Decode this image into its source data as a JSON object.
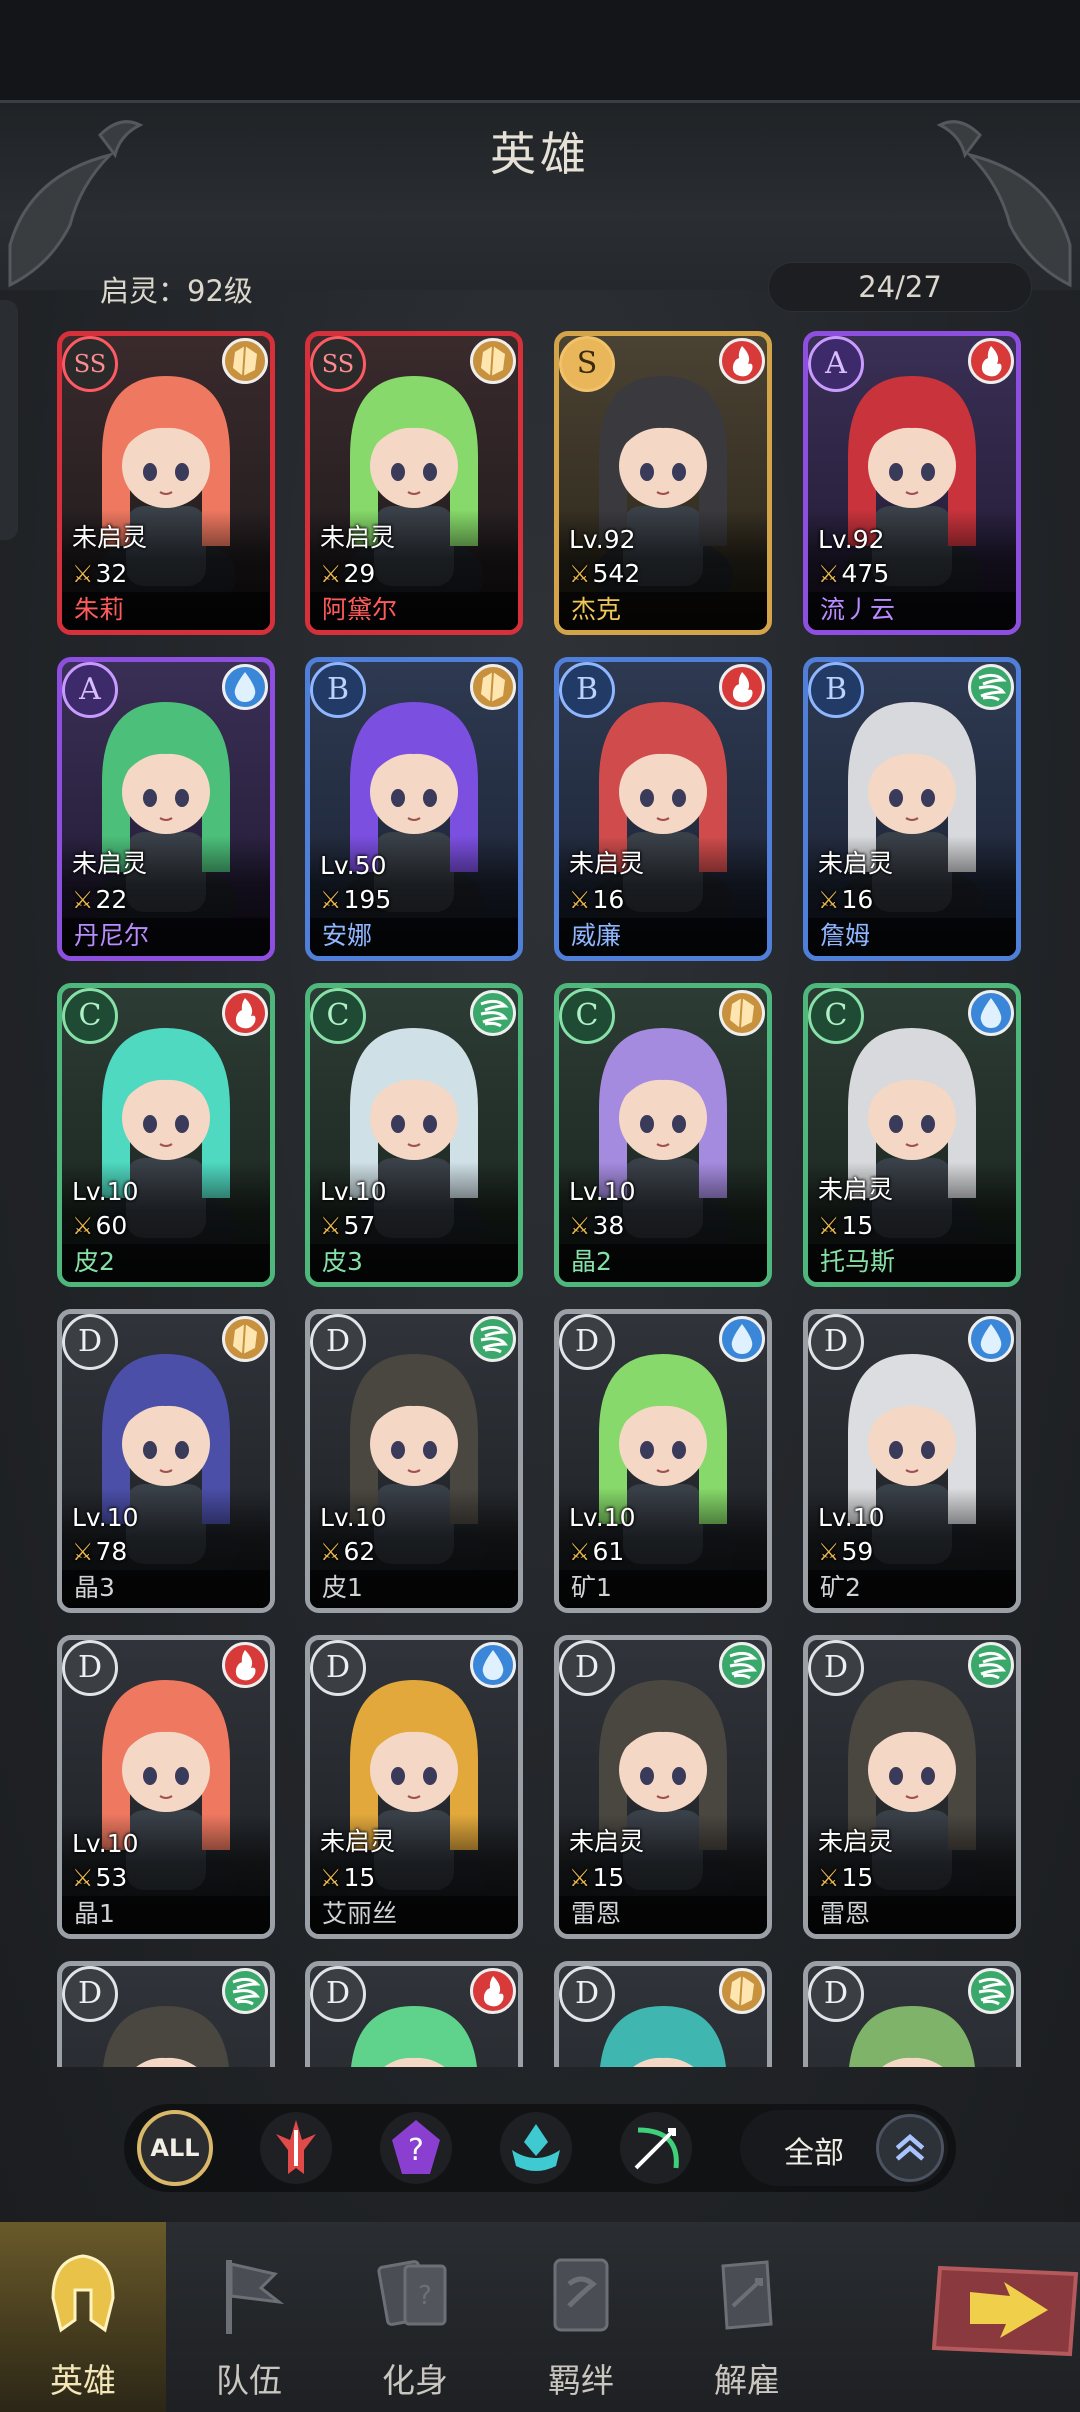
{
  "header": {
    "title": "英雄",
    "awaken_label": "启灵：92级",
    "hero_count": "24/27"
  },
  "heroes": [
    {
      "rank": "SS",
      "element": "earth",
      "level": "未启灵",
      "power": "32",
      "name": "朱莉",
      "hair": "#ee7860"
    },
    {
      "rank": "SS",
      "element": "earth",
      "level": "未启灵",
      "power": "29",
      "name": "阿黛尔",
      "hair": "#86d96a"
    },
    {
      "rank": "S",
      "element": "fire",
      "level": "Lv.92",
      "power": "542",
      "name": "杰克",
      "hair": "#3a3a3e"
    },
    {
      "rank": "A",
      "element": "fire",
      "level": "Lv.92",
      "power": "475",
      "name": "流丿云",
      "hair": "#c8333c"
    },
    {
      "rank": "A",
      "element": "water",
      "level": "未启灵",
      "power": "22",
      "name": "丹尼尔",
      "hair": "#4cbf7a"
    },
    {
      "rank": "B",
      "element": "earth",
      "level": "Lv.50",
      "power": "195",
      "name": "安娜",
      "hair": "#7b4fe0"
    },
    {
      "rank": "B",
      "element": "fire",
      "level": "未启灵",
      "power": "16",
      "name": "威廉",
      "hair": "#d04c4c"
    },
    {
      "rank": "B",
      "element": "wind",
      "level": "未启灵",
      "power": "16",
      "name": "詹姆",
      "hair": "#d8d9dc"
    },
    {
      "rank": "C",
      "element": "fire",
      "level": "Lv.10",
      "power": "60",
      "name": "皮2",
      "hair": "#4fd9c0"
    },
    {
      "rank": "C",
      "element": "wind",
      "level": "Lv.10",
      "power": "57",
      "name": "皮3",
      "hair": "#cfe0e6"
    },
    {
      "rank": "C",
      "element": "earth",
      "level": "Lv.10",
      "power": "38",
      "name": "晶2",
      "hair": "#a58be0"
    },
    {
      "rank": "C",
      "element": "water",
      "level": "未启灵",
      "power": "15",
      "name": "托马斯",
      "hair": "#d8d9dc"
    },
    {
      "rank": "D",
      "element": "earth",
      "level": "Lv.10",
      "power": "78",
      "name": "晶3",
      "hair": "#4b4fa8"
    },
    {
      "rank": "D",
      "element": "wind",
      "level": "Lv.10",
      "power": "62",
      "name": "皮1",
      "hair": "#4a4640"
    },
    {
      "rank": "D",
      "element": "water",
      "level": "Lv.10",
      "power": "61",
      "name": "矿1",
      "hair": "#86d96a"
    },
    {
      "rank": "D",
      "element": "water",
      "level": "Lv.10",
      "power": "59",
      "name": "矿2",
      "hair": "#dcdde0"
    },
    {
      "rank": "D",
      "element": "fire",
      "level": "Lv.10",
      "power": "53",
      "name": "晶1",
      "hair": "#ee7860"
    },
    {
      "rank": "D",
      "element": "water",
      "level": "未启灵",
      "power": "15",
      "name": "艾丽丝",
      "hair": "#e3a83c"
    },
    {
      "rank": "D",
      "element": "wind",
      "level": "未启灵",
      "power": "15",
      "name": "雷恩",
      "hair": "#4a4640"
    },
    {
      "rank": "D",
      "element": "wind",
      "level": "未启灵",
      "power": "15",
      "name": "雷恩",
      "hair": "#4a4640"
    },
    {
      "rank": "D",
      "element": "wind",
      "level": "",
      "power": "",
      "name": "",
      "hair": "#4a4640"
    },
    {
      "rank": "D",
      "element": "fire",
      "level": "",
      "power": "",
      "name": "",
      "hair": "#5fd28c"
    },
    {
      "rank": "D",
      "element": "earth",
      "level": "",
      "power": "",
      "name": "",
      "hair": "#3fb7b0"
    },
    {
      "rank": "D",
      "element": "wind",
      "level": "",
      "power": "",
      "name": "",
      "hair": "#7fb36a"
    }
  ],
  "filters": {
    "all_label": "ALL",
    "classes": [
      "warrior-class-icon",
      "mage-class-icon",
      "support-class-icon",
      "ranger-class-icon"
    ],
    "dropdown_label": "全部"
  },
  "nav": [
    {
      "label": "英雄",
      "icon": "helmet-icon",
      "active": true
    },
    {
      "label": "队伍",
      "icon": "flag-icon",
      "active": false
    },
    {
      "label": "化身",
      "icon": "cards-icon",
      "active": false
    },
    {
      "label": "羁绊",
      "icon": "book-icon",
      "active": false
    },
    {
      "label": "解雇",
      "icon": "scroll-icon",
      "active": false
    }
  ],
  "colors": {
    "rank_SS": "#d6303a",
    "rank_S": "#d4a44a",
    "rank_A": "#8e4fe0",
    "rank_B": "#4f7fd8",
    "rank_C": "#4db77c",
    "rank_D": "#9aa0a6"
  }
}
